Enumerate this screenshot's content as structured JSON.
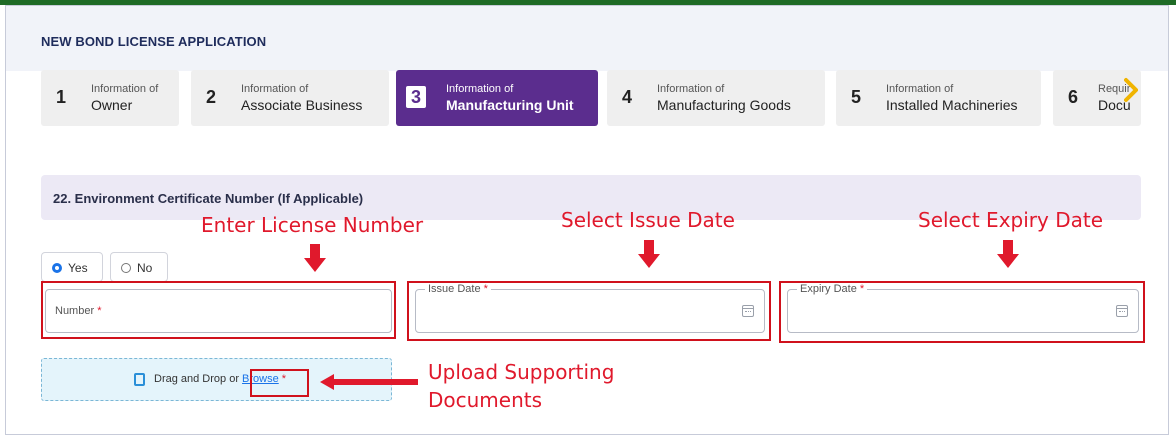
{
  "app_title": "NEW BOND LICENSE APPLICATION",
  "steps": [
    {
      "num": "1",
      "small": "Information of",
      "big": "Owner"
    },
    {
      "num": "2",
      "small": "Information of",
      "big": "Associate Business"
    },
    {
      "num": "3",
      "small": "Information of",
      "big": "Manufacturing Unit"
    },
    {
      "num": "4",
      "small": "Information of",
      "big": "Manufacturing Goods"
    },
    {
      "num": "5",
      "small": "Information of",
      "big": "Installed Machineries"
    },
    {
      "num": "6",
      "small": "Requir",
      "big": "Docu"
    }
  ],
  "active_step": "3",
  "section": {
    "title": "22. Environment Certificate Number (If Applicable)"
  },
  "radio": {
    "yes_label": "Yes",
    "no_label": "No",
    "selected": "Yes"
  },
  "fields": {
    "number_label": "Number",
    "issue_date_label": "Issue Date",
    "expiry_date_label": "Expiry Date",
    "required_mark": "*"
  },
  "upload": {
    "text": "Drag and Drop or ",
    "browse_label": "Browse"
  },
  "annotations": {
    "license_number": "Enter License Number",
    "issue_date": "Select Issue Date",
    "expiry_date": "Select Expiry Date",
    "upload_line1": "Upload Supporting",
    "upload_line2": "Documents"
  },
  "colors": {
    "active_step": "#5b2d8e",
    "annotation": "#e0192c",
    "top_bar": "#1f6b26"
  }
}
